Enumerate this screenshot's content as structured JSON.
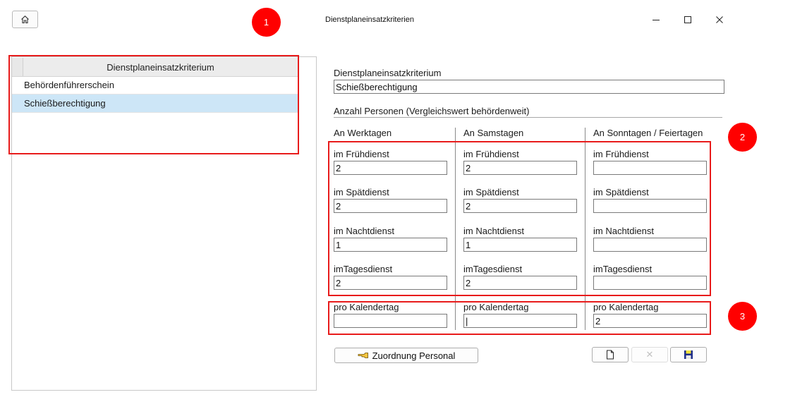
{
  "window": {
    "title": "Dienstplaneinsatzkriterien",
    "minimize_glyph": "—",
    "maximize_glyph": "☐",
    "close_glyph": "✕"
  },
  "home_button": {
    "icon": "home-icon"
  },
  "list": {
    "column_header": "Dienstplaneinsatzkriterium",
    "rows": [
      {
        "label": "Behördenführerschein",
        "selected": false
      },
      {
        "label": "Schießberechtigung",
        "selected": true
      }
    ]
  },
  "callouts": [
    "1",
    "2",
    "3"
  ],
  "form": {
    "criterion_label": "Dienstplaneinsatzkriterium",
    "criterion_value": "Schießberechtigung",
    "section_label": "Anzahl Personen (Vergleichswert behördenweit)",
    "columns": [
      {
        "header": "An Werktagen",
        "fields": [
          {
            "label": "im Frühdienst",
            "value": "2"
          },
          {
            "label": "im Spätdienst",
            "value": "2"
          },
          {
            "label": "im Nachtdienst",
            "value": "1"
          },
          {
            "label": "imTagesdienst",
            "value": "2"
          }
        ],
        "per_day": {
          "label": "pro Kalendertag",
          "value": ""
        }
      },
      {
        "header": "An Samstagen",
        "fields": [
          {
            "label": "im Frühdienst",
            "value": "2"
          },
          {
            "label": "im Spätdienst",
            "value": "2"
          },
          {
            "label": "im Nachtdienst",
            "value": "1"
          },
          {
            "label": "imTagesdienst",
            "value": "2"
          }
        ],
        "per_day": {
          "label": "pro Kalendertag",
          "value": "|"
        }
      },
      {
        "header": "An Sonntagen / Feiertagen",
        "fields": [
          {
            "label": "im Frühdienst",
            "value": ""
          },
          {
            "label": "im Spätdienst",
            "value": ""
          },
          {
            "label": "im Nachtdienst",
            "value": ""
          },
          {
            "label": "imTagesdienst",
            "value": ""
          }
        ],
        "per_day": {
          "label": "pro Kalendertag",
          "value": "2"
        }
      }
    ]
  },
  "buttons": {
    "assign_personnel": {
      "label": "Zuordnung Personal",
      "icon": "hand-pointing-icon"
    },
    "new_icon": "new-document-icon",
    "delete_glyph": "✕",
    "save_icon": "save-disk-icon"
  },
  "colors": {
    "highlight": "#e81b1b",
    "badge": "#ff0000",
    "selection": "#cde6f7"
  }
}
